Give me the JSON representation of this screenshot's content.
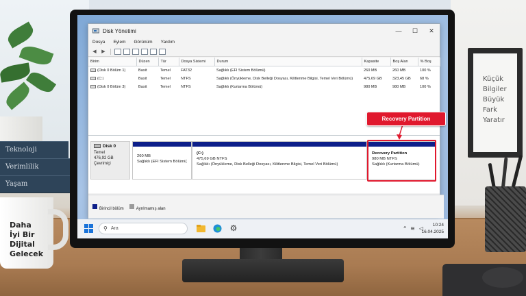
{
  "window": {
    "title": "Disk Yönetimi",
    "buttons": {
      "minimize": "—",
      "maximize": "☐",
      "close": "✕"
    }
  },
  "menu": [
    "Dosya",
    "Eylem",
    "Görünüm",
    "Yardım"
  ],
  "volume_table": {
    "headers": [
      "Birim",
      "Düzen",
      "Tür",
      "Dosya Sistemi",
      "Durum",
      "Kapasite",
      "Boş Alan",
      "% Boş"
    ],
    "rows": [
      [
        "(Disk 0 Bölüm 1)",
        "Basit",
        "Temel",
        "FAT32",
        "Sağlıklı (EFI Sistem Bölümü)",
        "260 MB",
        "260 MB",
        "100 %"
      ],
      [
        "(C:)",
        "Basit",
        "Temel",
        "NTFS",
        "Sağlıklı (Önyükleme, Disk Belleği Dosyası, Kilitlenme Bilgisi, Temel Veri Bölümü)",
        "475,69 GB",
        "323,45 GB",
        "68 %"
      ],
      [
        "(Disk 0 Bölüm 3)",
        "Basit",
        "Temel",
        "NTFS",
        "Sağlıklı (Kurtarma Bölümü)",
        "980 MB",
        "980 MB",
        "100 %"
      ]
    ]
  },
  "disk": {
    "name": "Disk 0",
    "type": "Temel",
    "size": "476,92 GB",
    "status": "Çevrimiçi",
    "partitions": [
      {
        "title": "",
        "size": "260 MB",
        "status": "Sağlıklı (EFI Sistem Bölümü)"
      },
      {
        "title": "(C:)",
        "size": "475,69 GB NTFS",
        "status": "Sağlıklı (Önyükleme, Disk Belleği Dosyası, Kilitlenme Bilgisi, Temel Veri Bölümü)"
      },
      {
        "title": "Recovery Partition",
        "size": "980 MB NTFS",
        "status": "Sağlıklı (Kurtarma Bölümü)"
      }
    ]
  },
  "legend": {
    "primary": "Birincil bölüm",
    "unallocated": "Ayrılmamış alan"
  },
  "callout": "Recovery Partition",
  "taskbar": {
    "search_placeholder": "Ara",
    "time": "10:24",
    "date": "16.04.2025"
  },
  "scene": {
    "frame_text": [
      "Küçük",
      "Bilgiler",
      "Büyük",
      "Fark Yaratır"
    ],
    "books": [
      "Teknoloji",
      "Verimlilik",
      "Yaşam"
    ],
    "mug_text": [
      "Daha",
      "İyi Bir",
      "Dijital",
      "Gelecek"
    ]
  },
  "colors": {
    "accent_red": "#e0182d",
    "primary_partition": "#0d1f8a",
    "unallocated": "#9a9a9a"
  }
}
